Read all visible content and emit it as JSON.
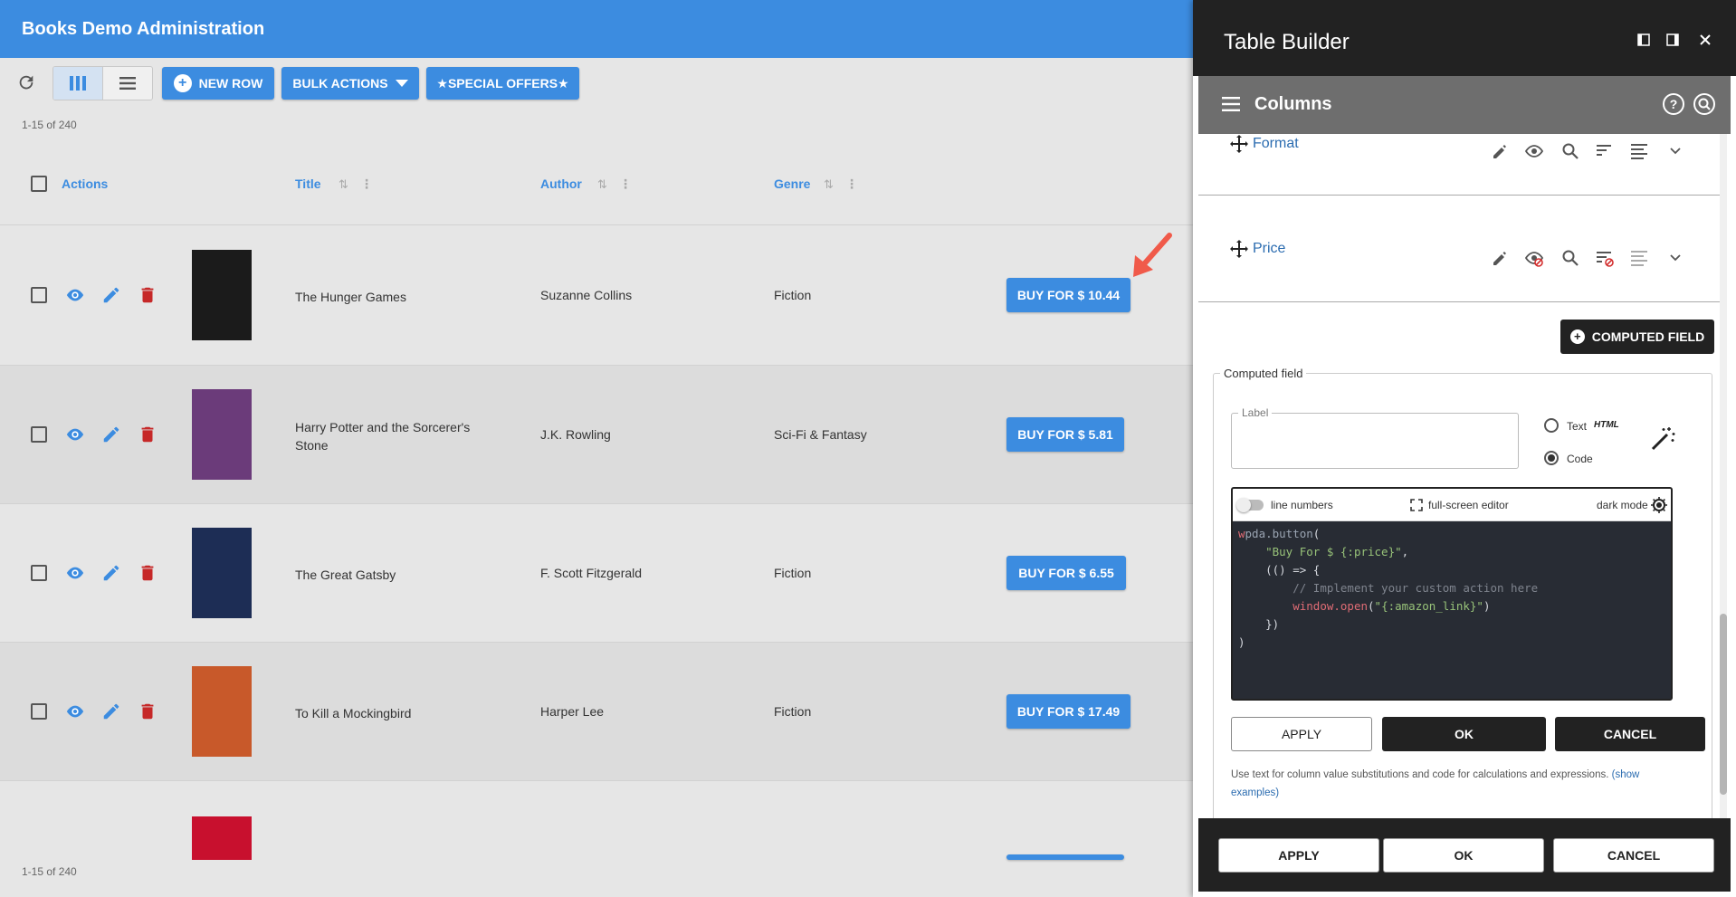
{
  "app": {
    "title": "Books Demo Administration"
  },
  "toolbar": {
    "new_row": "New Row",
    "bulk_actions": "Bulk Actions",
    "special_offers": "★Special Offers★"
  },
  "pagination": {
    "top": "1-15 of 240",
    "bottom": "1-15 of 240"
  },
  "table": {
    "headers": {
      "actions": "Actions",
      "title": "Title",
      "author": "Author",
      "genre": "Genre"
    },
    "rows": [
      {
        "title": "The Hunger Games",
        "author": "Suzanne Collins",
        "genre": "Fiction",
        "button": "Buy For $ 10.44",
        "cover_color": "#1b1b1b"
      },
      {
        "title": "Harry Potter and the Sorcerer's Stone",
        "author": "J.K. Rowling",
        "genre": "Sci-Fi & Fantasy",
        "button": "Buy For $ 5.81",
        "cover_color": "#6b3b7a"
      },
      {
        "title": "The Great Gatsby",
        "author": "F. Scott Fitzgerald",
        "genre": "Fiction",
        "button": "Buy For $ 6.55",
        "cover_color": "#1d2d55"
      },
      {
        "title": "To Kill a Mockingbird",
        "author": "Harper Lee",
        "genre": "Fiction",
        "button": "Buy For $ 17.49",
        "cover_color": "#c8592a"
      },
      {
        "title": "",
        "author": "",
        "genre": "",
        "button": "",
        "cover_color": "#c8102e"
      }
    ]
  },
  "panel": {
    "title": "Table Builder",
    "section": "Columns",
    "columns": [
      {
        "name": "Format"
      },
      {
        "name": "Price"
      }
    ],
    "computed_button": "Computed Field",
    "computed": {
      "legend": "Computed field",
      "label_legend": "Label",
      "label_value": "",
      "radio_text": "Text",
      "radio_html": "HTML",
      "radio_code": "Code",
      "line_numbers": "line numbers",
      "full_screen": "full-screen editor",
      "dark_mode": "dark mode",
      "apply": "Apply",
      "ok": "OK",
      "cancel": "Cancel",
      "help": "Use text for column value substitutions and code for calculations and expressions.",
      "help_link": "(show examples)"
    },
    "footer": {
      "apply": "Apply",
      "ok": "OK",
      "cancel": "Cancel"
    }
  },
  "colors": {
    "accent": "#3c8ce0",
    "danger": "#c62828",
    "panel_dark": "#222222"
  }
}
